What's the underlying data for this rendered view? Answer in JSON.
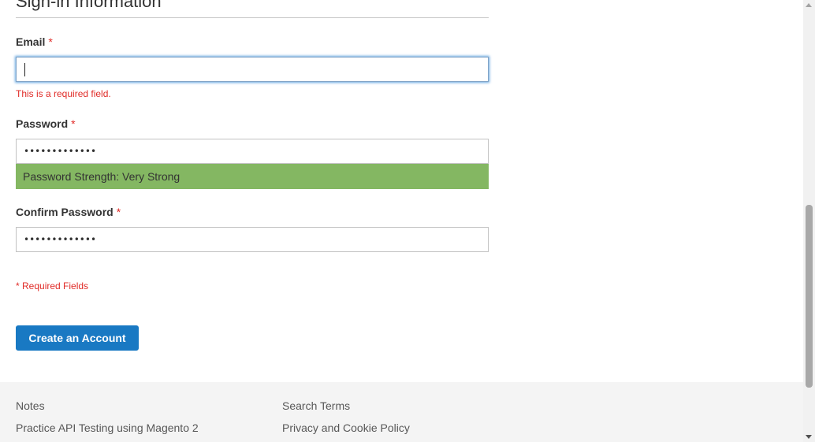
{
  "section": {
    "title": "Sign-in Information"
  },
  "email": {
    "label": "Email",
    "required_mark": "*",
    "value": "",
    "error": "This is a required field."
  },
  "password": {
    "label": "Password",
    "required_mark": "*",
    "value": "•••••••••••••",
    "strength_text": "Password Strength: Very Strong",
    "strength_color": "#84b762"
  },
  "confirm_password": {
    "label": "Confirm Password",
    "required_mark": "*",
    "value": "•••••••••••••"
  },
  "required_note": "* Required Fields",
  "submit": {
    "label": "Create an Account",
    "color": "#1979c3"
  },
  "footer": {
    "links": [
      {
        "label": "Notes"
      },
      {
        "label": "Practice API Testing using Magento 2"
      },
      {
        "label": "Search Terms"
      },
      {
        "label": "Privacy and Cookie Policy"
      }
    ]
  },
  "colors": {
    "error": "#e02b27",
    "footer_bg": "#f4f4f4"
  }
}
